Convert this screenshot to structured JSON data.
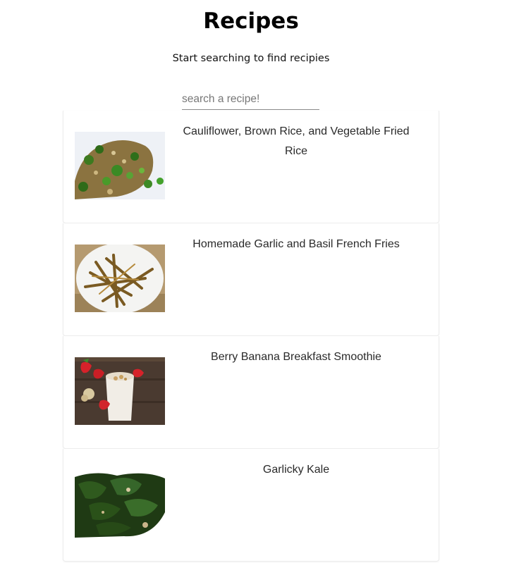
{
  "header": {
    "title": "Recipes",
    "subtitle": "Start searching to find recipies"
  },
  "search": {
    "placeholder": "search a recipe!",
    "value": ""
  },
  "recipes": [
    {
      "title": "Cauliflower, Brown Rice, and Vegetable Fried Rice",
      "image": "fried-rice-photo"
    },
    {
      "title": "Homemade Garlic and Basil French Fries",
      "image": "french-fries-photo"
    },
    {
      "title": "Berry Banana Breakfast Smoothie",
      "image": "smoothie-photo"
    },
    {
      "title": "Garlicky Kale",
      "image": "kale-photo"
    }
  ]
}
